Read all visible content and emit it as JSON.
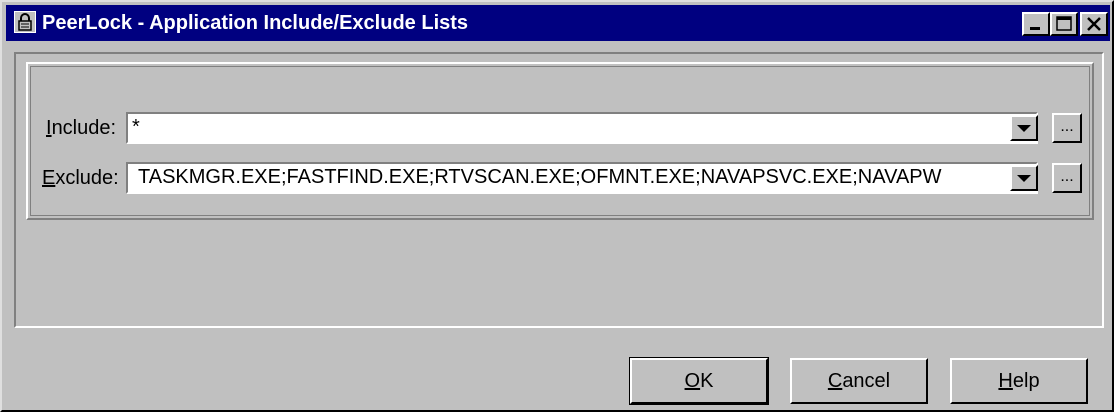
{
  "window": {
    "title": "PeerLock - Application Include/Exclude Lists",
    "icon": "padlock-icon",
    "controls": [
      "minimize-icon",
      "maximize-icon",
      "close-icon"
    ]
  },
  "include": {
    "label_mnemonic": "I",
    "label_rest": "nclude:",
    "value": "*"
  },
  "exclude": {
    "label_mnemonic": "E",
    "label_rest": "xclude:",
    "value": "TASKMGR.EXE;FASTFIND.EXE;RTVSCAN.EXE;OFMNT.EXE;NAVAPSVC.EXE;NAVAPW"
  },
  "browse_label": "...",
  "buttons": {
    "ok_mnemonic": "O",
    "ok_rest": "K",
    "cancel_mnemonic": "C",
    "cancel_rest": "ancel",
    "help_mnemonic": "H",
    "help_rest": "elp"
  }
}
